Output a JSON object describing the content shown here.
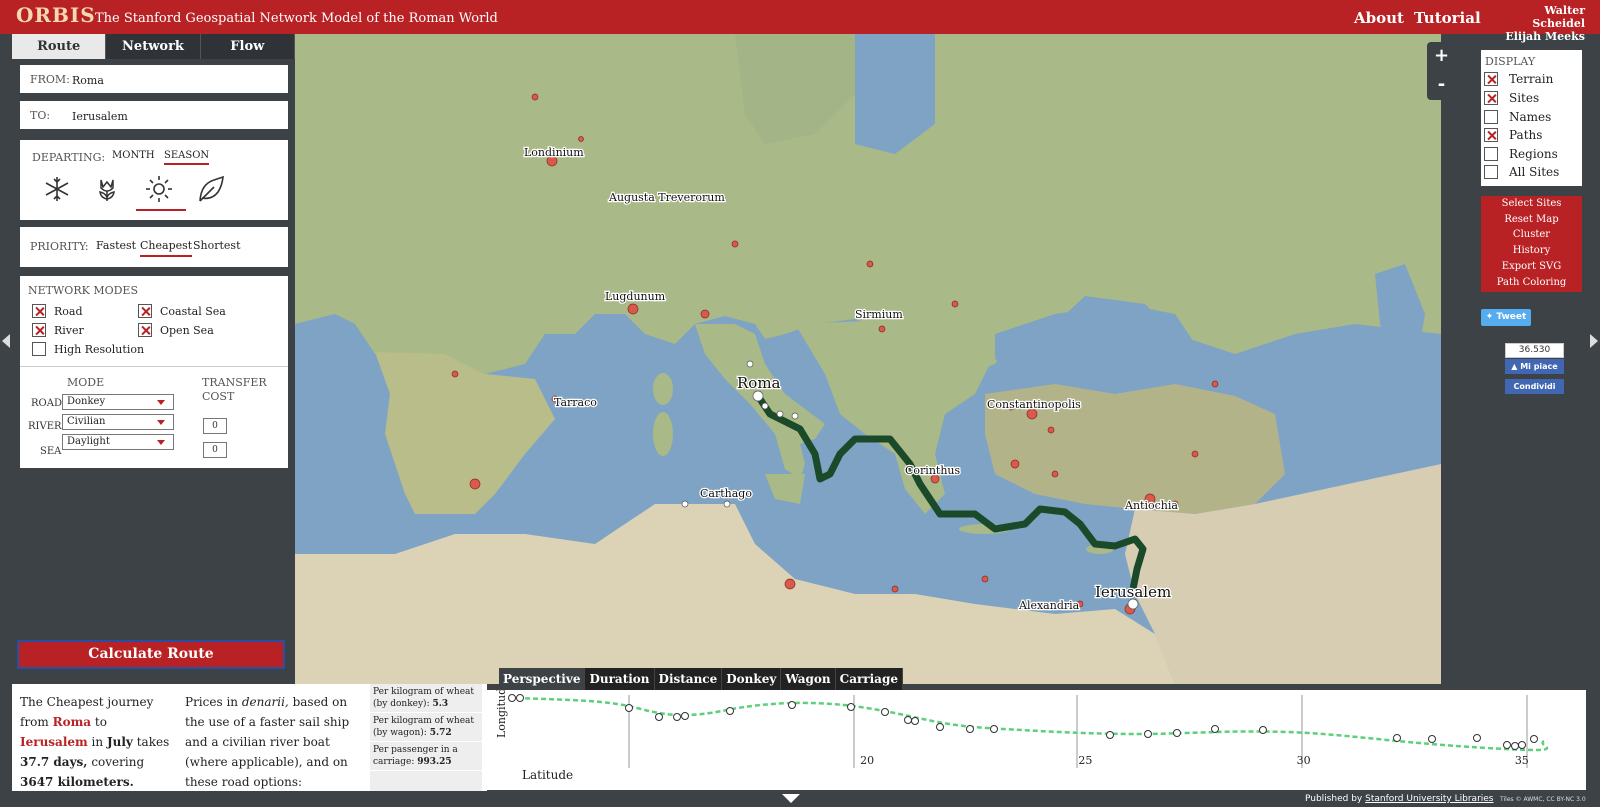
{
  "header": {
    "logo": "ORBIS",
    "subtitle": "The Stanford Geospatial Network Model of the Roman World",
    "nav_about": "About",
    "nav_tutorial": "Tutorial",
    "author1": "Walter Scheidel",
    "author2": "Elijah Meeks"
  },
  "tabs": [
    "Route",
    "Network",
    "Flow"
  ],
  "route_form": {
    "from_label": "FROM:",
    "from_value": "Roma",
    "to_label": "TO:",
    "to_value": "Ierusalem",
    "departing_label": "DEPARTING:",
    "month_label": "MONTH",
    "season_label": "SEASON",
    "seasons": [
      "winter-icon",
      "spring-icon",
      "summer-icon",
      "autumn-icon"
    ],
    "selected_season": "summer",
    "priority_label": "PRIORITY:",
    "priorities": [
      "Fastest",
      "Cheapest",
      "Shortest"
    ],
    "selected_priority": "Cheapest",
    "network_modes_title": "NETWORK MODES",
    "modes": [
      {
        "label": "Road",
        "checked": true
      },
      {
        "label": "Coastal Sea",
        "checked": true
      },
      {
        "label": "River",
        "checked": true
      },
      {
        "label": "Open Sea",
        "checked": true
      },
      {
        "label": "High Resolution",
        "checked": false
      }
    ],
    "mode_header": "MODE",
    "transfer_header_1": "TRANSFER",
    "transfer_header_2": "COST",
    "road_label": "ROAD",
    "road_mode": "Donkey",
    "river_label": "RIVER",
    "river_mode": "Civilian",
    "sea_label": "SEA",
    "sea_mode": "Daylight",
    "river_transfer": "0",
    "sea_transfer": "0",
    "calculate_label": "Calculate Route"
  },
  "map": {
    "accent_route": "#1a4a2a",
    "cities": [
      "Londinium",
      "Augusta Treverorum",
      "Lugdunum",
      "Sirmium",
      "Roma",
      "Tarraco",
      "Constantinopolis",
      "Corinthus",
      "Carthago",
      "Antiochia",
      "Alexandria",
      "Ierusalem"
    ],
    "zoom_in": "+",
    "zoom_out": "-"
  },
  "display": {
    "title": "DISPLAY",
    "options": [
      {
        "label": "Terrain",
        "checked": true
      },
      {
        "label": "Sites",
        "checked": true
      },
      {
        "label": "Names",
        "checked": false
      },
      {
        "label": "Paths",
        "checked": true
      },
      {
        "label": "Regions",
        "checked": false
      },
      {
        "label": "All Sites",
        "checked": false
      }
    ],
    "buttons": [
      "Select Sites",
      "Reset Map",
      "Cluster",
      "History",
      "Export SVG",
      "Path Coloring"
    ]
  },
  "social": {
    "tweet": "Tweet",
    "fb_count": "36.530",
    "fb_like": "Mi piace",
    "fb_share": "Condividi"
  },
  "summary": {
    "p1_a": "The Cheapest journey from",
    "from": "Roma",
    "to_word": "to",
    "to": "Ierusalem",
    "in_word": "in",
    "month": "July",
    "takes": "takes",
    "days": "37.7 days,",
    "covering": "covering",
    "km": "3647 kilometers.",
    "p2_a": "Prices in",
    "p2_currency": "denarii,",
    "p2_b": "based on the use of a faster sail ship and a civilian river boat (where applicable), and on these road options:",
    "costs": [
      {
        "label": "Per kilogram of wheat (by donkey):",
        "value": "5.3"
      },
      {
        "label": "Per kilogram of wheat (by wagon):",
        "value": "5.72"
      },
      {
        "label": "Per passenger in a carriage:",
        "value": "993.25"
      }
    ]
  },
  "chart_tabs": [
    "Perspective",
    "Duration",
    "Distance",
    "Donkey",
    "Wagon",
    "Carriage"
  ],
  "chart_data": {
    "type": "line",
    "xlabel": "Latitude",
    "ylabel": "Longitude",
    "x_ticks": [
      20,
      25,
      30,
      35
    ],
    "xlim": [
      12,
      35.6
    ]
  },
  "footer": {
    "published_by": "Published by",
    "library": "Stanford University Libraries",
    "tiles": "Tiles © AWMC, CC BY-NC 3.0"
  }
}
